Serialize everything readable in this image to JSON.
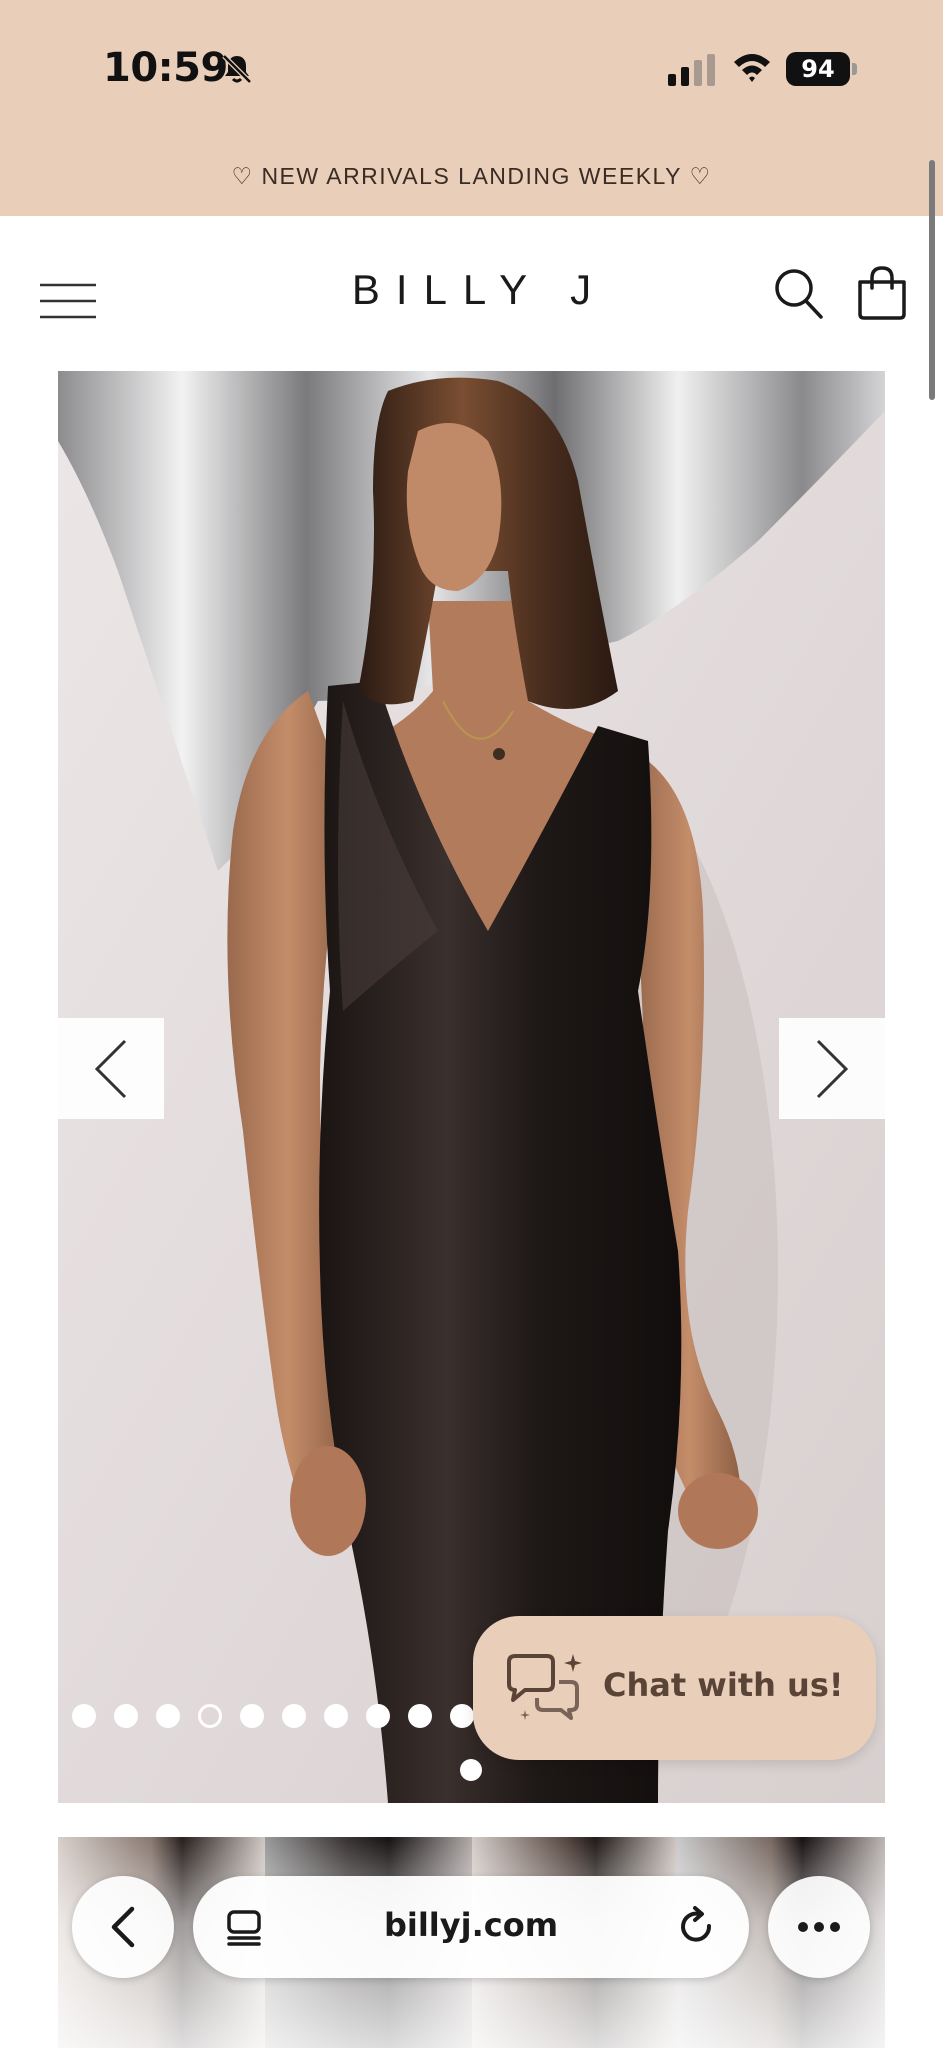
{
  "status_bar": {
    "time": "10:59",
    "battery_level": "94",
    "icons": [
      "bell-slash-icon",
      "cellular-signal-icon",
      "wifi-icon",
      "battery-icon"
    ]
  },
  "announcement": {
    "text": "♡ NEW ARRIVALS LANDING WEEKLY ♡"
  },
  "header": {
    "logo": "BILLY J",
    "icons": [
      "hamburger-menu-icon",
      "search-icon",
      "shopping-bag-icon"
    ]
  },
  "gallery": {
    "prev_icon": "chevron-left-icon",
    "next_icon": "chevron-right-icon",
    "slide_count": 11,
    "active_slide": 4
  },
  "chat": {
    "label": "Chat with us!",
    "icon": "chat-bubbles-sparkle-icon"
  },
  "browser": {
    "url": "billyj.com",
    "icons": [
      "back-chevron-icon",
      "tabs-icon",
      "reload-icon",
      "more-dots-icon"
    ]
  },
  "colors": {
    "banner": "#e9cfba",
    "chat_text": "#5a4438",
    "dress": "#221a18",
    "backdrop": "#e8e2e2"
  }
}
